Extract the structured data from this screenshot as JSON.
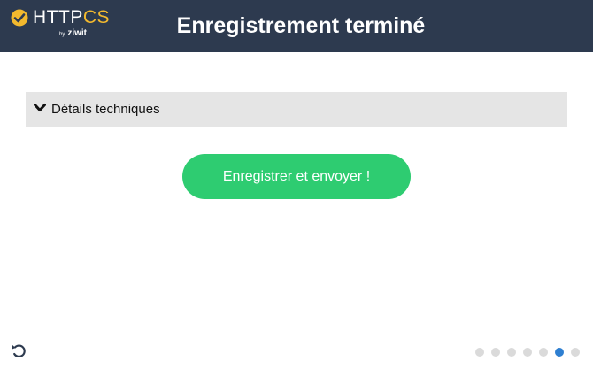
{
  "header": {
    "logo": {
      "name_part1": "HTTP",
      "name_part2": "CS",
      "by": "by",
      "brand": "ziwit"
    },
    "title": "Enregistrement terminé"
  },
  "details": {
    "label": "Détails techniques",
    "icon": "chevron-down-icon"
  },
  "submit": {
    "label": "Enregistrer et envoyer !"
  },
  "footer": {
    "undo_icon": "undo-icon",
    "steps_total": 7,
    "active_step": 6
  },
  "colors": {
    "header_bg": "#2d3a4f",
    "accent_yellow": "#f3b92e",
    "button_green": "#2ecc71",
    "active_dot": "#2e7fd1",
    "inactive_dot": "#dadada"
  }
}
